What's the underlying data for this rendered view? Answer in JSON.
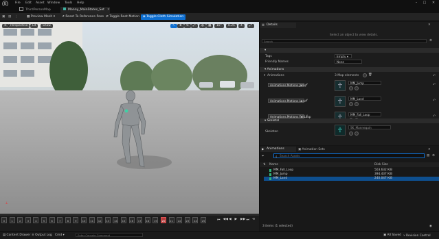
{
  "menu": {
    "items": [
      "File",
      "Edit",
      "Asset",
      "Window",
      "Tools",
      "Help"
    ],
    "window_controls": [
      "–",
      "□",
      "✕"
    ]
  },
  "tabs": [
    {
      "label": "ThirdPersonMap"
    },
    {
      "label": "Manny_MainStates_Set"
    }
  ],
  "toolbar": {
    "preview_mesh": "Preview Mesh",
    "reset_pose": "Reset To Reference Pose",
    "toggle_root_motion": "Toggle Root Motion",
    "toggle_cloth": "Toggle Cloth Simulation"
  },
  "viewport": {
    "perspective": "Perspective",
    "lit": "Lit",
    "show": "Show",
    "right_values": [
      "10°",
      "0.25",
      "4"
    ]
  },
  "timeline": {
    "ticks": [
      "0",
      "1",
      "2",
      "3",
      "4",
      "5",
      "6",
      "7",
      "8",
      "9",
      "10",
      "11",
      "12",
      "13",
      "14",
      "15",
      "16",
      "17",
      "18",
      "19",
      "20",
      "21",
      "22",
      "23",
      "24",
      "25"
    ],
    "current_frame": "20",
    "transport": [
      "⏮",
      "◀◀",
      "◀",
      "▶",
      "▶▶",
      "⏭",
      "⟲"
    ]
  },
  "status": {
    "content_drawer": "Content Drawer",
    "output_log": "Output Log",
    "cmd": "Cmd",
    "console_placeholder": "Enter Console Command",
    "all_saved": "All Saved",
    "revision_control": "Revision Control"
  },
  "details": {
    "tab_label": "Details",
    "hint": "Select an object to view details.",
    "search_placeholder": "Search",
    "tags_label": "Tags",
    "tags_value": "Empty",
    "friendly_names_label": "Friendly Names",
    "friendly_names_value": "None",
    "animations_section": "Animations",
    "animations_label": "Animations",
    "map_elements": "3 Map elements",
    "anim_entries": [
      {
        "key": "Animations.Motions.Jump",
        "asset": "MM_Jump"
      },
      {
        "key": "Animations.Motions.Land",
        "asset": "MM_Land"
      },
      {
        "key": "Animations.Motions.FallLoop",
        "asset": "MM_Fall_Loop"
      }
    ],
    "skeletal_section": "Skeletal",
    "skeleton_label": "Skeleton",
    "skeleton_value": "SK_Mannequin"
  },
  "assets": {
    "tab_animations": "Animations",
    "tab_animation_sets": "Animation Sets",
    "search_placeholder": "Search Assets",
    "col_name": "Name",
    "col_disk": "Disk Size",
    "rows": [
      {
        "name": "MM_Fall_Loop",
        "size": "503.632 KiB"
      },
      {
        "name": "MM_Jump",
        "size": "394.437 KiB"
      },
      {
        "name": "MM_Land",
        "size": "240.047 KiB"
      }
    ],
    "status": "3 items (1 selected)"
  },
  "colors": {
    "accent": "#0e6fd1",
    "panel": "#1c1c1c",
    "background": "#151515"
  }
}
